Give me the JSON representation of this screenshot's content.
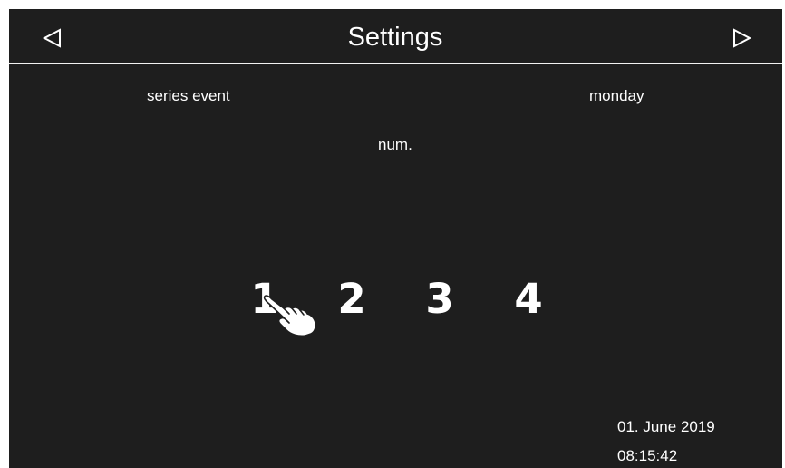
{
  "header": {
    "title": "Settings",
    "prev_icon": "triangle-left-icon",
    "next_icon": "triangle-right-icon"
  },
  "fields": {
    "series_label": "series event",
    "day_label": "monday",
    "num_label": "num."
  },
  "number_options": [
    "1",
    "2",
    "3",
    "4"
  ],
  "pointer_icon": "hand-pointer-icon",
  "footer": {
    "date": "01. June 2019",
    "time": "08:15:42"
  },
  "colors": {
    "background": "#1e1e1e",
    "foreground": "#ffffff",
    "frame": "#ffffff"
  }
}
